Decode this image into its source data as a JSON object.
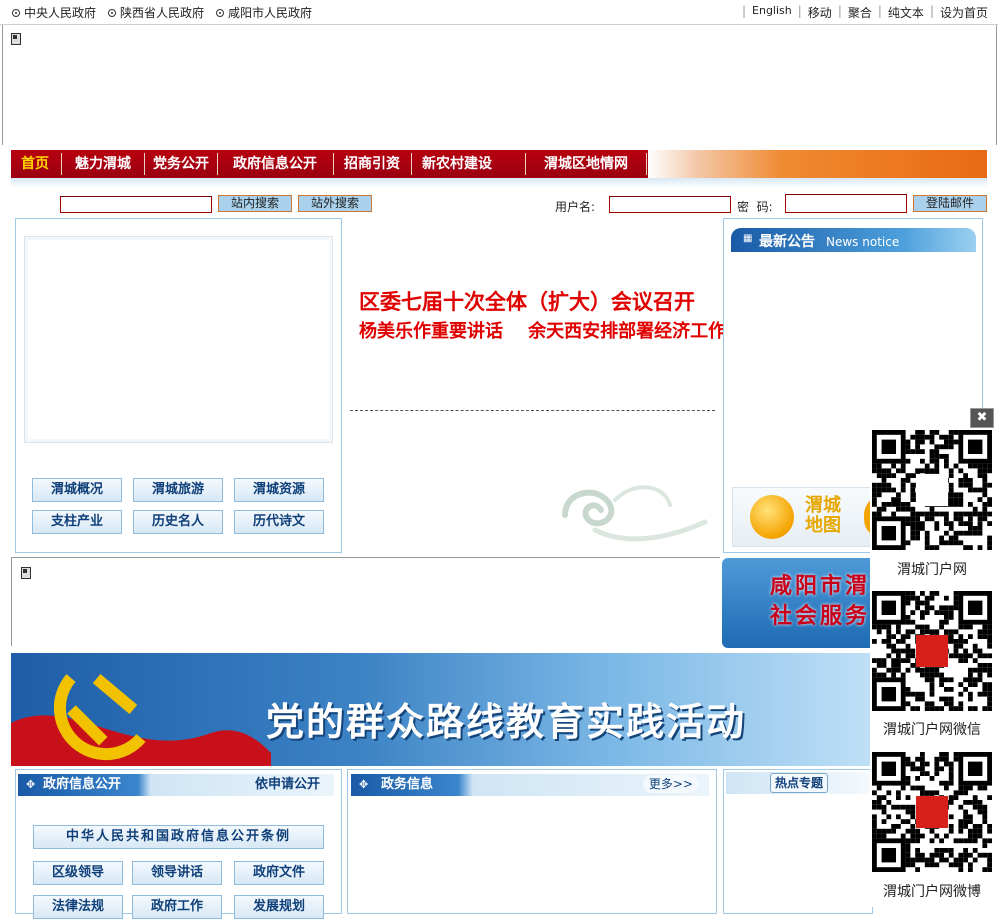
{
  "topbar": {
    "left_links": [
      "中央人民政府",
      "陕西省人民政府",
      "咸阳市人民政府"
    ],
    "right_links": [
      "English",
      "移动",
      "聚合",
      "纯文本",
      "设为首页"
    ]
  },
  "nav": {
    "items": [
      "首页",
      "魅力渭城",
      "党务公开",
      "政府信息公开",
      "招商引资",
      "新农村建设",
      "渭城区地情网"
    ]
  },
  "search": {
    "site_search_label": "站内搜索",
    "web_search_label": "站外搜索",
    "username_label": "用户名:",
    "password_label": "密  码:",
    "mail_login_label": "登陆邮件"
  },
  "categories": [
    "渭城概况",
    "渭城旅游",
    "渭城资源",
    "支柱产业",
    "历史名人",
    "历代诗文"
  ],
  "headline": {
    "line1": "区委七届十次全体（扩大）会议召开",
    "line2": "杨美乐作重要讲话    余天西安排部署经济工作"
  },
  "notice": {
    "title": "最新公告",
    "subtitle": "News notice"
  },
  "map_tile": {
    "text": "渭城地图"
  },
  "social_service_tile": {
    "text": "咸阳市渭城区社会服务"
  },
  "banner": {
    "text": "党的群众路线教育实践活动"
  },
  "sections": {
    "gov_info": {
      "title": "政府信息公开",
      "right": "依申请公开",
      "wide_button": "中华人民共和国政府信息公开条例",
      "buttons": [
        "区级领导",
        "领导讲话",
        "政府文件",
        "法律法规",
        "政府工作",
        "发展规划"
      ]
    },
    "affairs": {
      "title": "政务信息",
      "more": "更多>>"
    },
    "hot": {
      "title": "热点专题"
    }
  },
  "qr_codes": [
    {
      "caption": "渭城门户网",
      "icon": "v-logo-icon"
    },
    {
      "caption": "渭城门户网微信",
      "icon": "party-badge-icon"
    },
    {
      "caption": "渭城门户网微博",
      "icon": "party-badge-icon"
    }
  ],
  "colors": {
    "nav_red": "#b8000f",
    "headline_red": "#e00000",
    "panel_border": "#9ec8e6",
    "nav_active": "#ffd800"
  }
}
